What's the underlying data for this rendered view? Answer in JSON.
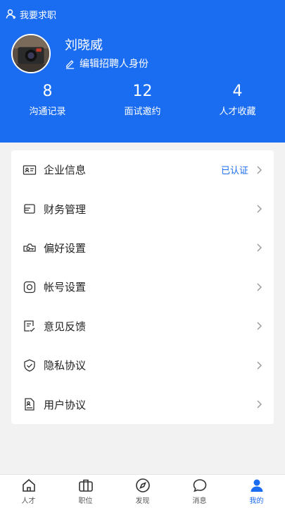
{
  "header": {
    "job_seek_label": "我要求职",
    "user_name": "刘晓威",
    "edit_label": "编辑招聘人身份",
    "stats": [
      {
        "value": "8",
        "label": "沟通记录"
      },
      {
        "value": "12",
        "label": "面试邀约"
      },
      {
        "value": "4",
        "label": "人才收藏"
      }
    ]
  },
  "menu": {
    "items": [
      {
        "label": "企业信息",
        "status": "已认证",
        "icon": "id-card-icon"
      },
      {
        "label": "财务管理",
        "status": "",
        "icon": "wallet-icon"
      },
      {
        "label": "偏好设置",
        "status": "",
        "icon": "key-icon"
      },
      {
        "label": "帐号设置",
        "status": "",
        "icon": "camera-square-icon"
      },
      {
        "label": "意见反馈",
        "status": "",
        "icon": "feedback-icon"
      },
      {
        "label": "隐私协议",
        "status": "",
        "icon": "shield-check-icon"
      },
      {
        "label": "用户协议",
        "status": "",
        "icon": "document-icon"
      }
    ]
  },
  "tabbar": {
    "tabs": [
      {
        "label": "人才",
        "icon": "home-icon",
        "active": false
      },
      {
        "label": "职位",
        "icon": "briefcase-icon",
        "active": false
      },
      {
        "label": "发现",
        "icon": "compass-icon",
        "active": false
      },
      {
        "label": "消息",
        "icon": "chat-icon",
        "active": false
      },
      {
        "label": "我的",
        "icon": "person-icon",
        "active": true
      }
    ]
  },
  "colors": {
    "accent": "#1a6cf0",
    "background": "#f2f2f2"
  }
}
